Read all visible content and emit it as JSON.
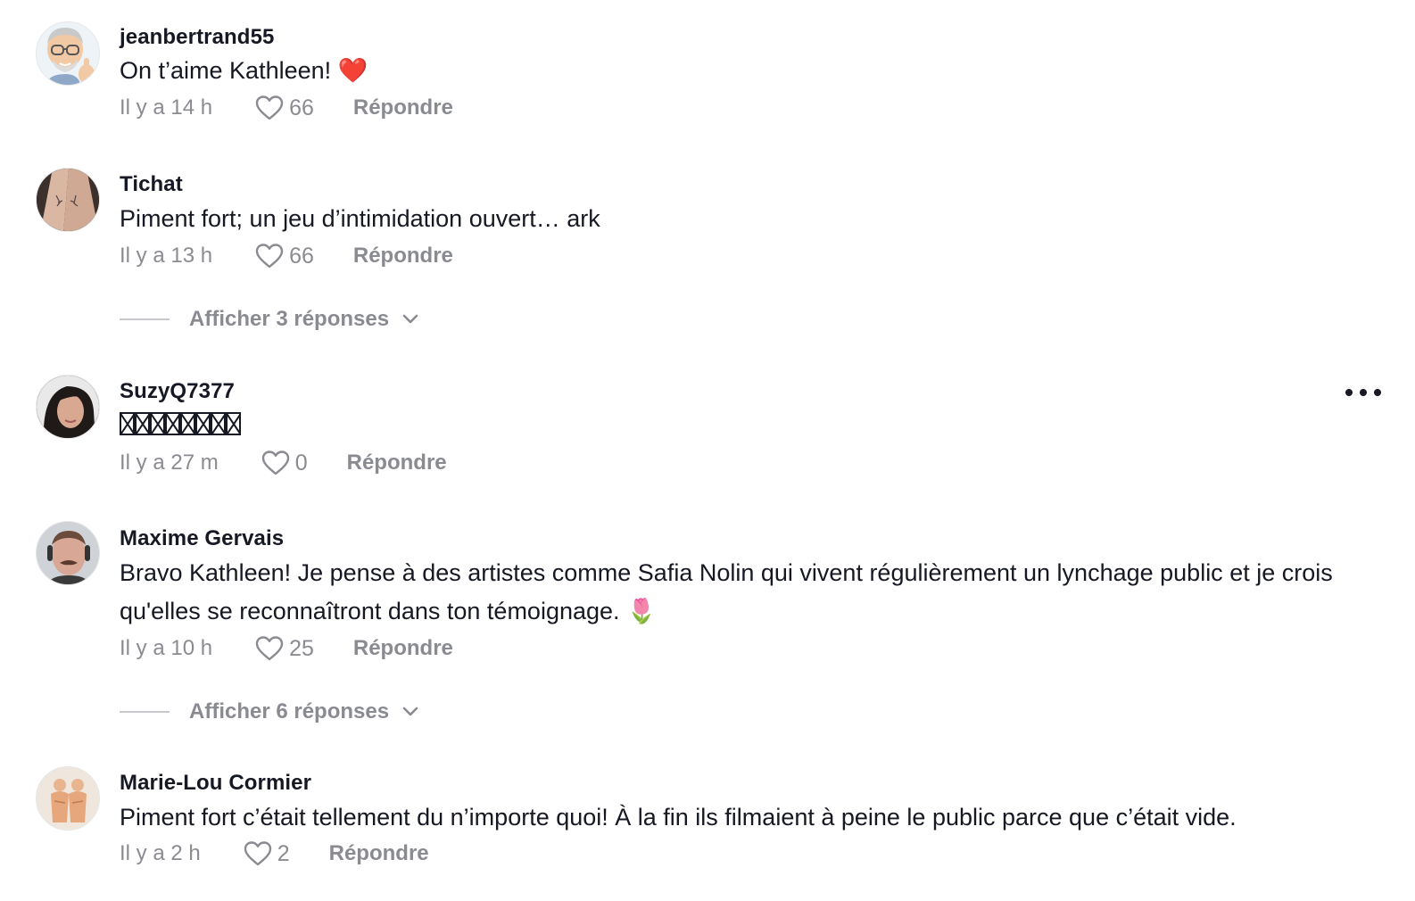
{
  "comments": [
    {
      "username": "jeanbertrand55",
      "text": "On t’aime Kathleen! ❤️",
      "time": "Il y a 14 h",
      "likes": "66",
      "reply_label": "Répondre"
    },
    {
      "username": "Tichat",
      "text": "Piment fort; un jeu d’intimidation ouvert… ark",
      "time": "Il y a 13 h",
      "likes": "66",
      "reply_label": "Répondre",
      "view_replies": "Afficher 3 réponses"
    },
    {
      "username": "SuzyQ7377",
      "text": "",
      "time": "Il y a 27 m",
      "likes": "0",
      "reply_label": "Répondre"
    },
    {
      "username": "Maxime Gervais",
      "text": "Bravo Kathleen! Je pense à des artistes comme Safia Nolin qui vivent régulièrement un lynchage public et je crois qu'elles se reconnaîtront dans ton témoignage. 🌷",
      "time": "Il y a 10 h",
      "likes": "25",
      "reply_label": "Répondre",
      "view_replies": "Afficher 6 réponses"
    },
    {
      "username": "Marie-Lou Cormier",
      "text": "Piment fort c’était tellement du n’importe quoi! À la fin ils filmaient à peine le public parce que c’était vide.",
      "time": "Il y a 2 h",
      "likes": "2",
      "reply_label": "Répondre"
    }
  ],
  "icons": {
    "like": "heart-outline-icon",
    "more": "more-options-icon",
    "expand": "chevron-down-icon"
  },
  "colors": {
    "text": "#161823",
    "muted": "#8a8b91",
    "heart_emoji": "#e0182d"
  }
}
